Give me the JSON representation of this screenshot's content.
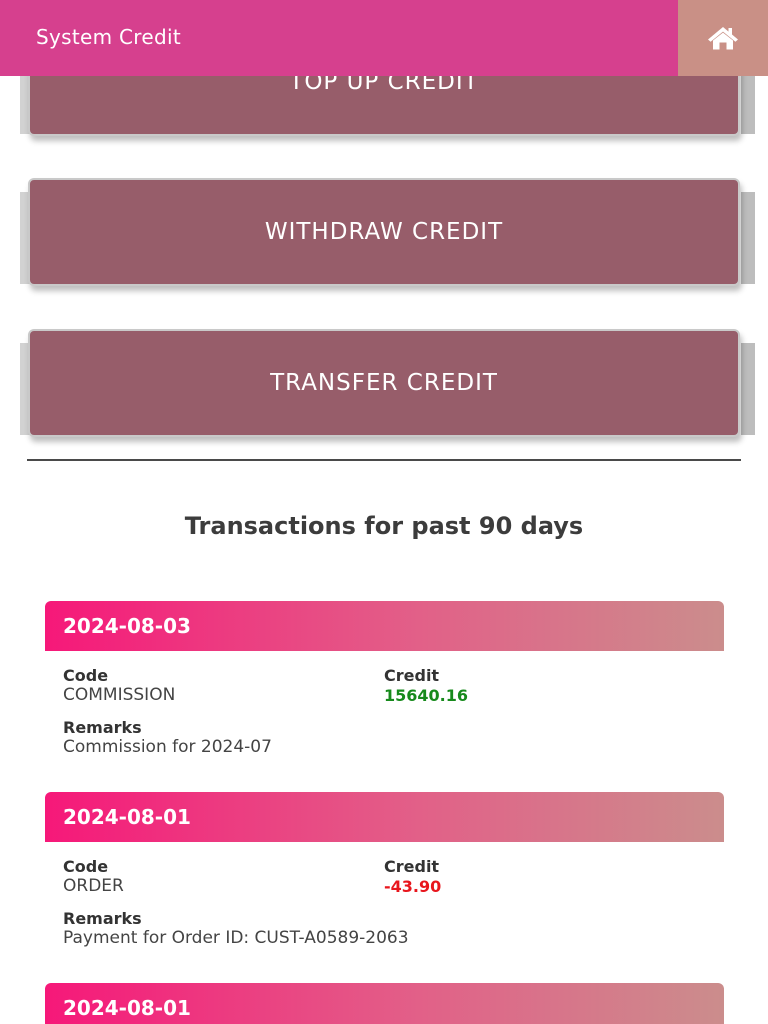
{
  "header": {
    "title": "System Credit",
    "home_icon": "home-icon"
  },
  "actions": [
    {
      "label": "TOP UP CREDIT"
    },
    {
      "label": "WITHDRAW CREDIT"
    },
    {
      "label": "TRANSFER CREDIT"
    }
  ],
  "transactions_heading": "Transactions for past 90 days",
  "transactions": [
    {
      "date": "2024-08-03",
      "code_label": "Code",
      "code": "COMMISSION",
      "credit_label": "Credit",
      "credit": "15640.16",
      "remarks_label": "Remarks",
      "remarks": "Commission for 2024-07"
    },
    {
      "date": "2024-08-01",
      "code_label": "Code",
      "code": "ORDER",
      "credit_label": "Credit",
      "credit": "-43.90",
      "remarks_label": "Remarks",
      "remarks": "Payment for Order ID: CUST-A0589-2063"
    },
    {
      "date": "2024-08-01"
    }
  ],
  "colors": {
    "header": "#d6408e",
    "home_button": "#c99086",
    "action_button": "#975d6a",
    "credit_positive": "#178a1c",
    "credit_negative": "#e8161d"
  }
}
